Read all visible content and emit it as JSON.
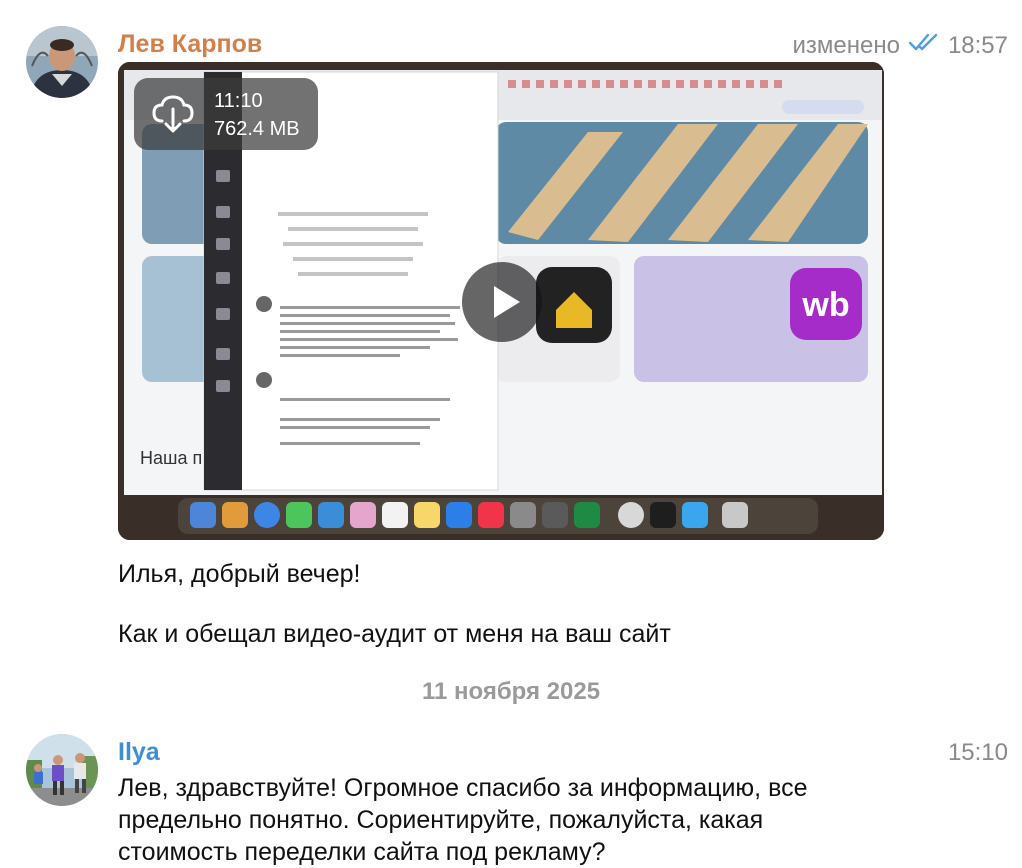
{
  "colors": {
    "sender1": "#d2804a",
    "sender2": "#3d8ed6",
    "read_check": "#4a9fe0",
    "meta_gray": "#8a8a8a"
  },
  "message1": {
    "sender": "Лев Карпов",
    "edited": "изменено",
    "time": "18:57",
    "status_icon": "double-check-icon",
    "video": {
      "duration": "11:10",
      "size": "762.4 MB",
      "download_icon": "cloud-download-icon",
      "play_icon": "play-icon",
      "preview_texts": {
        "headline": "Наша п",
        "card_logo": "wb"
      }
    },
    "text_line1": "Илья, добрый вечер!",
    "text_line2": "Как и обещал видео-аудит от меня на ваш сайт"
  },
  "date_separator": "11 ноября 2025",
  "message2": {
    "sender": "Ilya",
    "time": "15:10",
    "lines": [
      "Лев, здравствуйте! Огромное спасибо за информацию, все",
      "предельно понятно. Сориентируйте, пожалуйста, какая",
      "стоимость переделки сайта под рекламу?"
    ]
  }
}
